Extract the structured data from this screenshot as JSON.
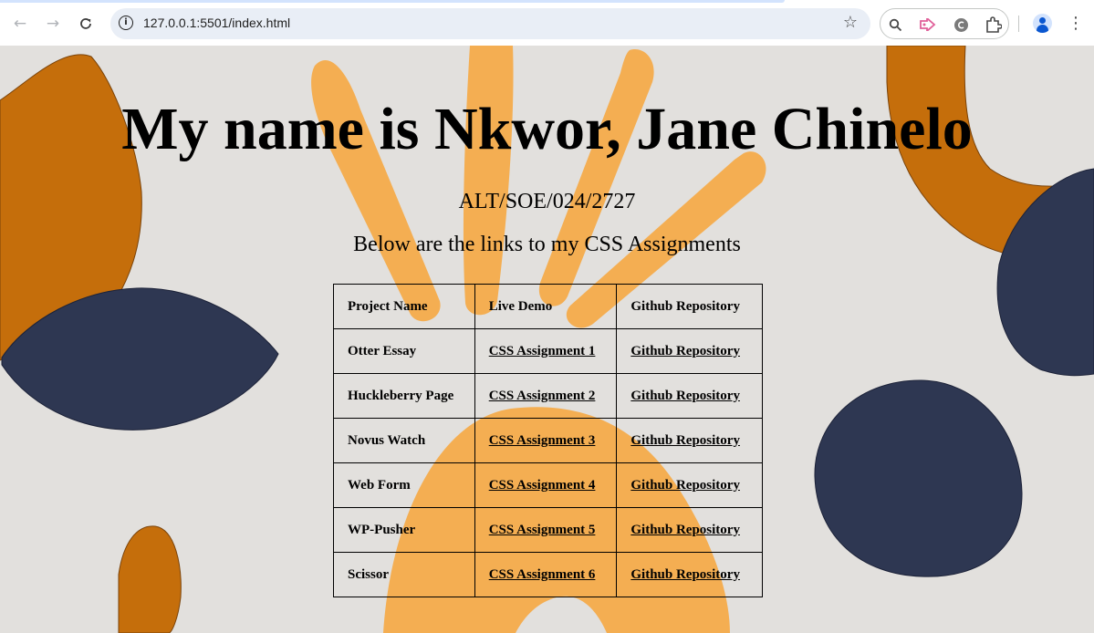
{
  "browser": {
    "url": "127.0.0.1:5501/index.html",
    "icons": {
      "back": "back-arrow-icon",
      "forward": "forward-arrow-icon",
      "reload": "reload-icon",
      "site_info": "site-info-icon",
      "bookmark": "star-icon",
      "extensions": [
        "search-extension-icon",
        "arrow-extension-icon",
        "copyright-extension-icon",
        "puzzle-extensions-icon"
      ],
      "profile": "profile-avatar-icon",
      "menu": "kebab-menu-icon"
    }
  },
  "page": {
    "title": "My name is Nkwor, Jane Chinelo",
    "student_id": "ALT/SOE/024/2727",
    "intro": "Below are the links to my CSS Assignments",
    "table": {
      "headers": [
        "Project Name",
        "Live Demo",
        "Github Repository"
      ],
      "rows": [
        {
          "name": "Otter Essay",
          "demo": "CSS Assignment 1",
          "repo": "Github Repository"
        },
        {
          "name": "Huckleberry Page",
          "demo": "CSS Assignment 2",
          "repo": "Github Repository"
        },
        {
          "name": "Novus Watch",
          "demo": "CSS Assignment 3",
          "repo": "Github Repository"
        },
        {
          "name": "Web Form",
          "demo": "CSS Assignment 4",
          "repo": "Github Repository"
        },
        {
          "name": "WP-Pusher",
          "demo": "CSS Assignment 5",
          "repo": "Github Repository"
        },
        {
          "name": "Scissor",
          "demo": "CSS Assignment 6",
          "repo": "Github Repository"
        }
      ]
    }
  },
  "colors": {
    "background": "#e2e0dd",
    "burnt_orange": "#c56e0b",
    "light_orange": "#f4ae52",
    "navy": "#2e3752",
    "table_cell": "#dddcdc"
  }
}
